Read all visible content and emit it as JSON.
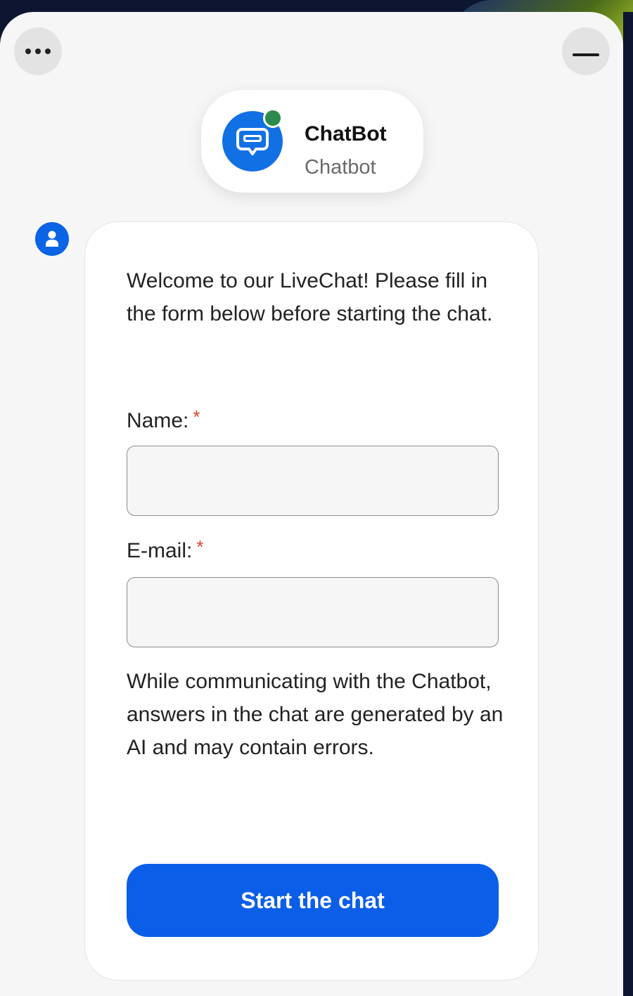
{
  "header": {
    "menu_icon": "more-horizontal-icon",
    "minimize_icon": "minimize-icon"
  },
  "agent": {
    "name": "ChatBot",
    "role": "Chatbot",
    "avatar_icon": "chat-bubble-icon",
    "status": "online",
    "status_color": "#2d8a4e",
    "avatar_color": "#1170e4"
  },
  "form": {
    "user_icon": "user-icon",
    "welcome_message": "Welcome to our LiveChat! Please fill in the form below before starting the chat.",
    "name_label": "Name:",
    "name_required_mark": "*",
    "name_value": "",
    "email_label": "E-mail:",
    "email_required_mark": "*",
    "email_value": "",
    "disclaimer": "While communicating with the Chatbot, answers in the chat are generated by an AI and may contain errors.",
    "submit_label": "Start the chat"
  },
  "colors": {
    "accent": "#0b5ee8",
    "required": "#d9452e",
    "background": "#f6f6f6"
  }
}
